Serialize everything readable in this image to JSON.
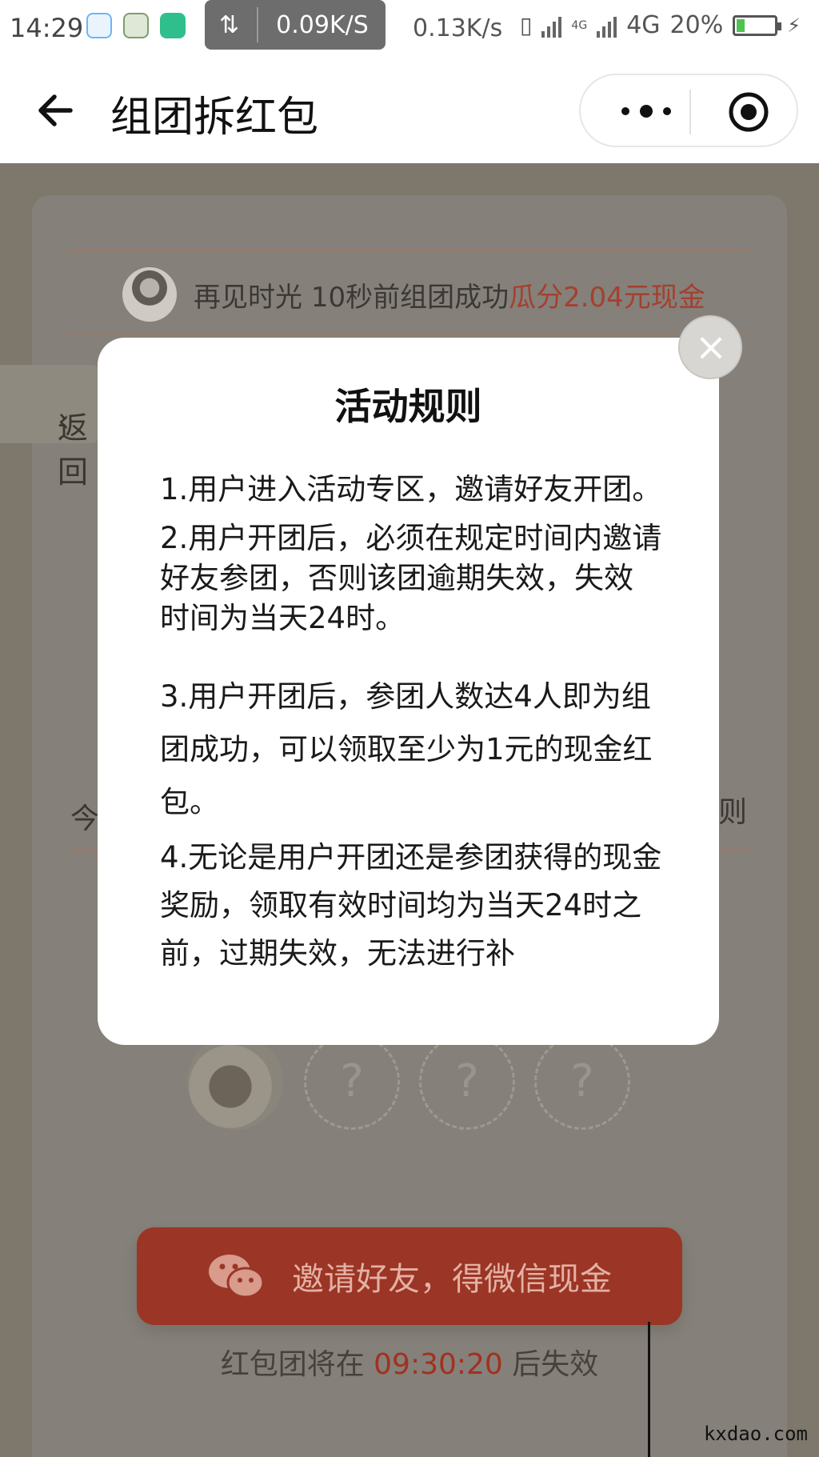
{
  "status_bar": {
    "time": "14:29",
    "net_speed_pill": "0.09K/S",
    "net_speed": "0.13K/s",
    "network_type": "4G",
    "mini_label": "4G",
    "battery": "20%",
    "battery_level": 0.2
  },
  "nav": {
    "title": "组团拆红包"
  },
  "ticker": {
    "name": "再见时光",
    "time_ago": "10秒前组团成功",
    "reward": "瓜分2.04元现金"
  },
  "background": {
    "back_tab_label": "返回",
    "fragment_left": "今",
    "fragment_right": "则"
  },
  "members": {
    "unknown_mark": "?"
  },
  "invite": {
    "button_label": "邀请好友，得微信现金"
  },
  "countdown": {
    "prefix": "红包团将在",
    "time": "09:30:20",
    "suffix": "后失效"
  },
  "modal": {
    "title": "活动规则",
    "rules": [
      "1.用户进入活动专区，邀请好友开团。",
      "2.用户开团后，必须在规定时间内邀请好友参团，否则该团逾期失效，失效时间为当天24时。",
      "3.用户开团后，参团人数达4人即为组团成功，可以领取至少为1元的现金红包。",
      "4.无论是用户开团还是参团获得的现金奖励，领取有效时间均为当天24时之前，过期失效，无法进行补"
    ],
    "close_label": "×"
  },
  "watermark": "kxdao.com",
  "colors": {
    "highlight_red": "#a4402d",
    "button_red": "#9b3525",
    "overlay_bg": "#7d786b"
  }
}
